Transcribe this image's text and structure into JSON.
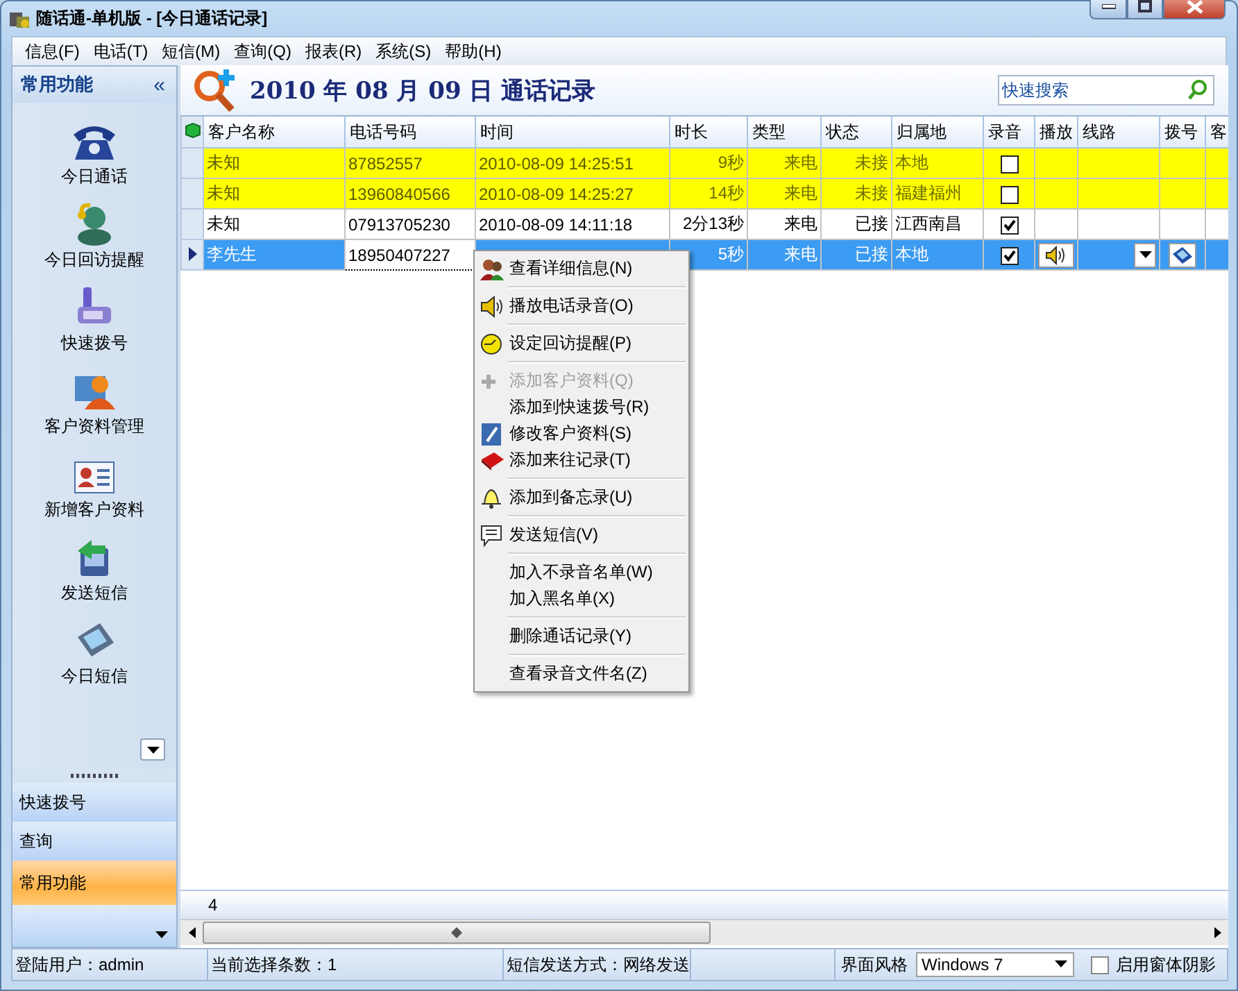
{
  "window": {
    "title": "随话通-单机版 - [今日通话记录]"
  },
  "menu": [
    "信息(F)",
    "电话(T)",
    "短信(M)",
    "查询(Q)",
    "报表(R)",
    "系统(S)",
    "帮助(H)"
  ],
  "sidebar": {
    "title": "常用功能",
    "collapse": "«",
    "items": [
      {
        "label": "今日通话"
      },
      {
        "label": "今日回访提醒"
      },
      {
        "label": "快速拨号"
      },
      {
        "label": "客户资料管理"
      },
      {
        "label": "新增客户资料"
      },
      {
        "label": "发送短信"
      },
      {
        "label": "今日短信"
      }
    ],
    "nav": [
      {
        "label": "快速拨号",
        "selected": false
      },
      {
        "label": "查询",
        "selected": false
      },
      {
        "label": "常用功能",
        "selected": true
      }
    ]
  },
  "page_title": "2010 年 08 月 09 日 通话记录",
  "search": {
    "placeholder": "快速搜索"
  },
  "table": {
    "columns": [
      "客户名称",
      "电话号码",
      "时间",
      "时长",
      "类型",
      "状态",
      "归属地",
      "录音",
      "播放",
      "线路",
      "拨号",
      "客"
    ],
    "rows": [
      {
        "name": "未知",
        "phone": "87852557",
        "time": "2010-08-09 14:25:51",
        "duration": "9秒",
        "type": "来电",
        "status": "未接",
        "location": "本地",
        "recorded": false,
        "highlighted": true,
        "selected": false
      },
      {
        "name": "未知",
        "phone": "13960840566",
        "time": "2010-08-09 14:25:27",
        "duration": "14秒",
        "type": "来电",
        "status": "未接",
        "location": "福建福州",
        "recorded": false,
        "highlighted": true,
        "selected": false
      },
      {
        "name": "未知",
        "phone": "07913705230",
        "time": "2010-08-09 14:11:18",
        "duration": "2分13秒",
        "type": "来电",
        "status": "已接",
        "location": "江西南昌",
        "recorded": true,
        "highlighted": false,
        "selected": false
      },
      {
        "name": "李先生",
        "phone": "18950407227",
        "duration": "5秒",
        "type": "来电",
        "status": "已接",
        "location": "本地",
        "recorded": true,
        "highlighted": false,
        "selected": true
      }
    ],
    "footer_count": "4"
  },
  "context_menu": [
    [
      {
        "label": "查看详细信息(N)",
        "disabled": false
      }
    ],
    [
      {
        "label": "播放电话录音(O)",
        "disabled": false
      }
    ],
    [
      {
        "label": "设定回访提醒(P)",
        "disabled": false
      }
    ],
    [
      {
        "label": "添加客户资料(Q)",
        "disabled": true
      },
      {
        "label": "添加到快速拨号(R)",
        "disabled": false
      },
      {
        "label": "修改客户资料(S)",
        "disabled": false
      },
      {
        "label": "添加来往记录(T)",
        "disabled": false
      }
    ],
    [
      {
        "label": "添加到备忘录(U)",
        "disabled": false
      }
    ],
    [
      {
        "label": "发送短信(V)",
        "disabled": false
      }
    ],
    [
      {
        "label": "加入不录音名单(W)",
        "disabled": false
      },
      {
        "label": "加入黑名单(X)",
        "disabled": false
      }
    ],
    [
      {
        "label": "删除通话记录(Y)",
        "disabled": false
      }
    ],
    [
      {
        "label": "查看录音文件名(Z)",
        "disabled": false
      }
    ]
  ],
  "status_bar": {
    "fields": [
      "登陆用户：admin",
      "当前选择条数：1",
      "短信发送方式：网络发送"
    ],
    "theme_label": "界面风格",
    "theme_value": "Windows 7",
    "shadow_option": {
      "label": "启用窗体阴影",
      "checked": false
    }
  }
}
